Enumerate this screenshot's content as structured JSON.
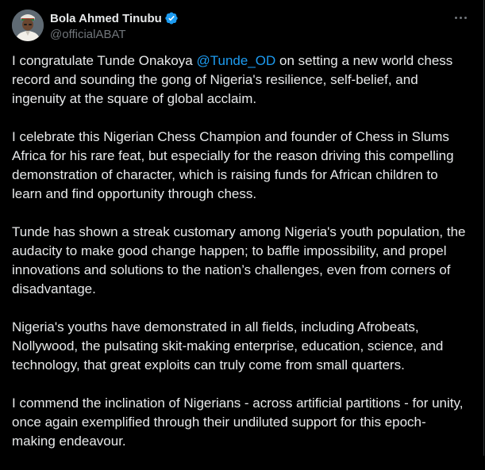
{
  "author": {
    "display_name": "Bola Ahmed Tinubu",
    "handle": "@officialABAT",
    "verified_color": "#1d9bf0"
  },
  "colors": {
    "background": "#000000",
    "text": "#e7e9ea",
    "muted": "#71767b",
    "link": "#1d9bf0"
  },
  "icons": {
    "avatar": "avatar",
    "verified": "verified-badge-icon",
    "more": "more-options-icon"
  },
  "tweet": {
    "p1_before": "I congratulate Tunde Onakoya ",
    "p1_mention": "@Tunde_OD",
    "p1_after": " on setting a new world chess record and sounding the gong of Nigeria's resilience, self-belief, and ingenuity at the square of global acclaim.",
    "p2": "I celebrate this Nigerian Chess Champion and founder of Chess in Slums Africa for his rare feat, but especially for the reason driving this compelling demonstration of character, which is raising funds for African children to learn and find opportunity through chess.",
    "p3": "Tunde has shown a streak customary among Nigeria's youth population, the audacity to make good change happen; to baffle impossibility, and propel innovations and solutions to the nation’s challenges, even from corners of disadvantage.",
    "p4": "Nigeria's youths have demonstrated in all fields, including Afrobeats, Nollywood, the pulsating skit-making enterprise, education, science, and technology, that great exploits can truly come from small quarters.",
    "p5": "I commend the inclination of Nigerians - across artificial partitions - for unity, once again exemplified through their undiluted support for this epoch-making endeavour."
  }
}
